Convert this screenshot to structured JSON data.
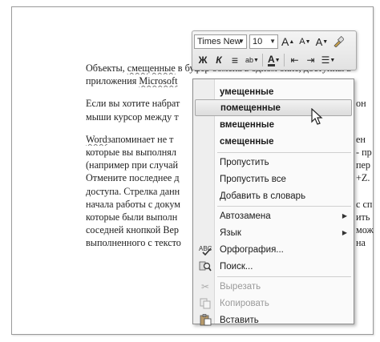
{
  "document": {
    "p1": [
      [
        "Объекты, ",
        "смещенные",
        " в буфер обмена в одном окне, доступны в"
      ],
      [
        "приложения ",
        "Microsoft"
      ]
    ],
    "p2": [
      "Если вы хотите  набрат",
      "мыши курсор между т"
    ],
    "p2_right": [
      "он",
      "он"
    ],
    "p3": [
      [
        "Word",
        "запоминает не т"
      ],
      "которые вы выполнял",
      "(например при случай",
      "Отмените последнее  д",
      "доступа. Стрелка данн",
      "начала работы с докум",
      "которые были выполн",
      "соседней кнопкой Вер",
      "выполненного с тексто"
    ],
    "p3_right": [
      "ен",
      "- пр",
      "пер",
      "+Z.",
      "",
      "с сп",
      "ить",
      "мож",
      "на"
    ]
  },
  "mini_toolbar": {
    "font_name": "Times New",
    "font_size": "10",
    "grow_font": "A",
    "shrink_font": "A",
    "styles": "A",
    "bold": "Ж",
    "italic": "К",
    "center": "≡",
    "highlight": "ab",
    "font_color": "A",
    "decrease_indent": "⇤",
    "increase_indent": "⇥",
    "bullets": "☰"
  },
  "context_menu": {
    "suggestions": [
      "умещенные",
      "помещенные",
      "вмещенные",
      "смещенные"
    ],
    "hovered_index": 1,
    "items": [
      {
        "label": "Пропустить",
        "icon": ""
      },
      {
        "label": "Пропустить все",
        "icon": ""
      },
      {
        "label": "Добавить в словарь",
        "icon": ""
      },
      {
        "label": "Автозамена",
        "submenu": true
      },
      {
        "label": "Язык",
        "submenu": true
      },
      {
        "label": "Орфография...",
        "icon": "spelling-icon"
      },
      {
        "label": "Поиск...",
        "icon": "research-icon"
      },
      {
        "label": "Вырезать",
        "icon": "cut-icon",
        "disabled": true
      },
      {
        "label": "Копировать",
        "icon": "copy-icon",
        "disabled": true
      },
      {
        "label": "Вставить",
        "icon": "paste-icon"
      }
    ]
  }
}
